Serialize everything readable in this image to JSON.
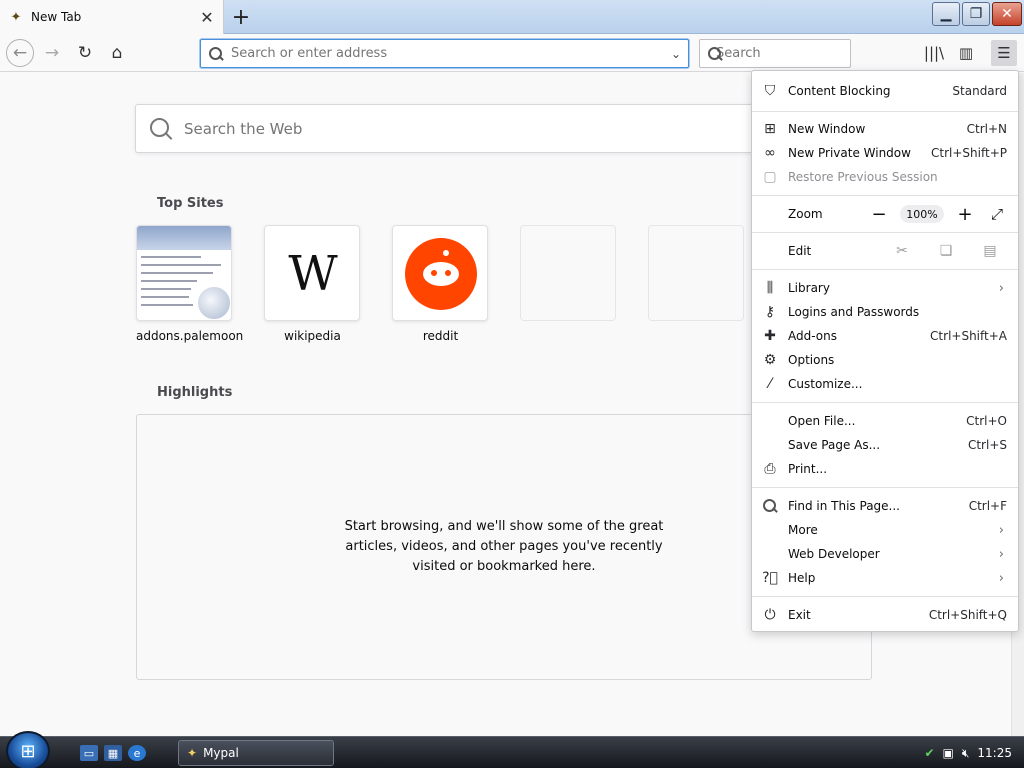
{
  "tab": {
    "title": "New Tab"
  },
  "nav": {
    "url_placeholder": "Search or enter address",
    "search_placeholder": "Search"
  },
  "page": {
    "web_search_placeholder": "Search the Web",
    "top_sites_title": "Top Sites",
    "top_sites": [
      {
        "label": "addons.palemoon"
      },
      {
        "label": "wikipedia"
      },
      {
        "label": "reddit"
      },
      {
        "label": ""
      },
      {
        "label": ""
      }
    ],
    "highlights_title": "Highlights",
    "highlights_empty": "Start browsing, and we'll show some of the great articles, videos, and other pages you've recently visited or bookmarked here."
  },
  "menu": {
    "content_blocking": {
      "label": "Content Blocking",
      "value": "Standard"
    },
    "new_window": {
      "label": "New Window",
      "shortcut": "Ctrl+N"
    },
    "new_private_window": {
      "label": "New Private Window",
      "shortcut": "Ctrl+Shift+P"
    },
    "restore_session": {
      "label": "Restore Previous Session"
    },
    "zoom": {
      "label": "Zoom",
      "value": "100%"
    },
    "edit": {
      "label": "Edit"
    },
    "library": {
      "label": "Library"
    },
    "logins": {
      "label": "Logins and Passwords"
    },
    "addons": {
      "label": "Add-ons",
      "shortcut": "Ctrl+Shift+A"
    },
    "options": {
      "label": "Options"
    },
    "customize": {
      "label": "Customize..."
    },
    "open_file": {
      "label": "Open File...",
      "shortcut": "Ctrl+O"
    },
    "save_page": {
      "label": "Save Page As...",
      "shortcut": "Ctrl+S"
    },
    "print": {
      "label": "Print..."
    },
    "find": {
      "label": "Find in This Page...",
      "shortcut": "Ctrl+F"
    },
    "more": {
      "label": "More"
    },
    "web_developer": {
      "label": "Web Developer"
    },
    "help": {
      "label": "Help"
    },
    "exit": {
      "label": "Exit",
      "shortcut": "Ctrl+Shift+Q"
    }
  },
  "taskbar": {
    "app_label": "Mypal",
    "clock": "11:25"
  },
  "colors": {
    "accent": "#4a90d9",
    "reddit": "#ff4500"
  }
}
